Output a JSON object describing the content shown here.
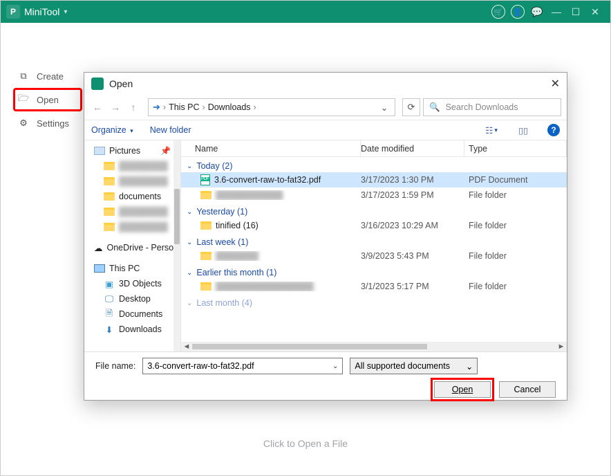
{
  "app": {
    "title": "MiniTool",
    "sidebar": {
      "create": "Create",
      "open": "Open",
      "settings": "Settings"
    },
    "hint": "Click to Open a File"
  },
  "dialog": {
    "title": "Open",
    "breadcrumb": {
      "root": "This PC",
      "folder": "Downloads"
    },
    "search_placeholder": "Search Downloads",
    "toolbar": {
      "organize": "Organize",
      "newfolder": "New folder"
    },
    "columns": {
      "name": "Name",
      "date": "Date modified",
      "type": "Type"
    },
    "tree": {
      "pictures": "Pictures",
      "documents_folder": "documents",
      "onedrive": "OneDrive - Person",
      "thispc": "This PC",
      "objects3d": "3D Objects",
      "desktop": "Desktop",
      "documents": "Documents",
      "downloads": "Downloads"
    },
    "groups": {
      "today": "Today (2)",
      "yesterday": "Yesterday (1)",
      "lastweek": "Last week (1)",
      "earlier": "Earlier this month (1)",
      "lastmonth": "Last month (4)"
    },
    "rows": {
      "r1": {
        "name": "3.6-convert-raw-to-fat32.pdf",
        "date": "3/17/2023 1:30 PM",
        "type": "PDF Document"
      },
      "r2": {
        "name": "███████████",
        "date": "3/17/2023 1:59 PM",
        "type": "File folder"
      },
      "r3": {
        "name": "tinified (16)",
        "date": "3/16/2023 10:29 AM",
        "type": "File folder"
      },
      "r4": {
        "name": "███████",
        "date": "3/9/2023 5:43 PM",
        "type": "File folder"
      },
      "r5": {
        "name": "████████████████",
        "date": "3/1/2023 5:17 PM",
        "type": "File folder"
      }
    },
    "footer": {
      "file_label": "File name:",
      "file_value": "3.6-convert-raw-to-fat32.pdf",
      "filter": "All supported documents",
      "open_btn": "Open",
      "cancel_btn": "Cancel"
    }
  }
}
